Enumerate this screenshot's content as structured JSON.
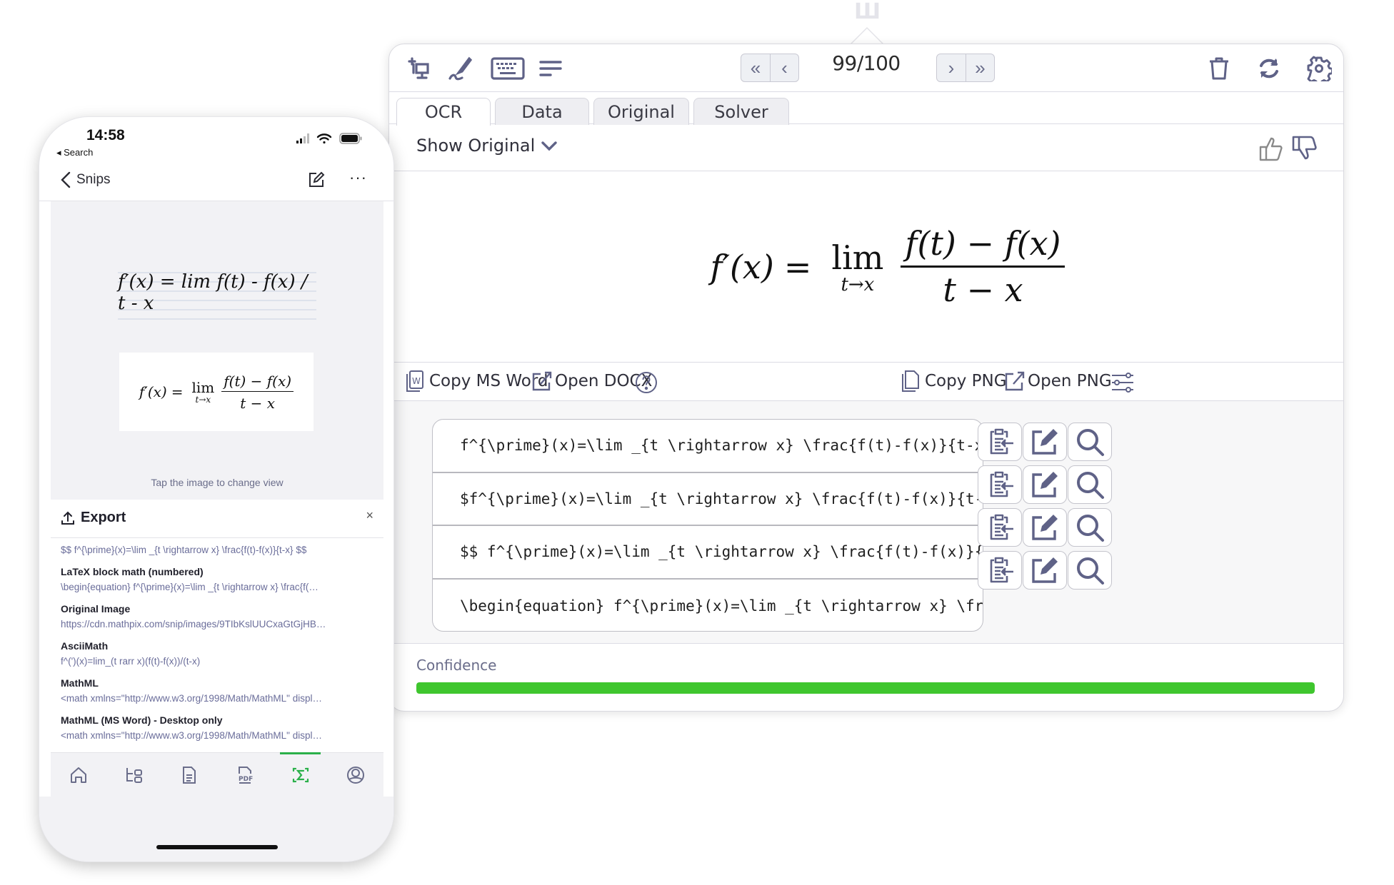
{
  "desktop": {
    "logo_glyph": "Ш",
    "toolbar": {
      "icons": [
        "screen-snip-icon",
        "handwriting-icon",
        "keyboard-icon",
        "menu-lines-icon"
      ],
      "nav": {
        "first": "«",
        "prev": "‹",
        "next": "›",
        "last": "»"
      },
      "page_counter": "99/100",
      "right_icons": [
        "trash-icon",
        "refresh-icon",
        "gear-icon"
      ]
    },
    "tabs": [
      {
        "label": "OCR",
        "active": true
      },
      {
        "label": "Data",
        "active": false
      },
      {
        "label": "Original",
        "active": false
      },
      {
        "label": "Solver",
        "active": false
      }
    ],
    "show_original_label": "Show Original",
    "rendered_math": {
      "lhs": "f′(x)",
      "eq": "=",
      "lim": "lim",
      "lim_sub": "t→x",
      "numerator": "f(t) − f(x)",
      "denominator": "t − x"
    },
    "export_bar": {
      "copy_word": "Copy MS Word",
      "open_docx": "Open DOCX",
      "copy_png": "Copy PNG",
      "open_png": "Open PNG"
    },
    "latex_formats": [
      "f^{\\prime}(x)=\\lim _{t \\rightarrow x} \\frac{f(t)-f(x)}{t-x}",
      "$f^{\\prime}(x)=\\lim _{t \\rightarrow x} \\frac{f(t)-f(x)}{t-x}$",
      "$$ f^{\\prime}(x)=\\lim _{t \\rightarrow x} \\frac{f(t)-f(x)}{t-x} $$",
      "\\begin{equation} f^{\\prime}(x)=\\lim _{t \\rightarrow x} \\frac{f(t)-f(…"
    ],
    "confidence": {
      "label": "Confidence",
      "value_percent": 100,
      "color": "#3fc62e"
    },
    "icon_color": "#5f6287"
  },
  "phone": {
    "status": {
      "time": "14:58",
      "back_label": "◂ Search"
    },
    "nav": {
      "back_label": "Snips",
      "more": "···"
    },
    "preview": {
      "handwritten": "f′(x) = lim f(t) - f(x) / t - x",
      "tap_hint": "Tap the image to change view"
    },
    "rendered_math": {
      "lhs": "f′(x)",
      "eq": "=",
      "lim": "lim",
      "lim_sub": "t→x",
      "numerator": "f(t) − f(x)",
      "denominator": "t − x"
    },
    "export": {
      "title": "Export",
      "close": "×",
      "partial_value": "$$ f^{\\prime}(x)=\\lim _{t \\rightarrow x} \\frac{f(t)-f(x)}{t-x} $$",
      "items": [
        {
          "name": "LaTeX block math (numbered)",
          "value": "\\begin{equation} f^{\\prime}(x)=\\lim _{t \\rightarrow x} \\frac{f(…"
        },
        {
          "name": "Original Image",
          "value": "https://cdn.mathpix.com/snip/images/9TIbKslUUCxaGtGjHB…"
        },
        {
          "name": "AsciiMath",
          "value": "f^(')(x)=lim_(t rarr x)(f(t)-f(x))/(t-x)"
        },
        {
          "name": "MathML",
          "value": "<math xmlns=\"http://www.w3.org/1998/Math/MathML\" displ…"
        },
        {
          "name": "MathML (MS Word) - Desktop only",
          "value": "<math xmlns=\"http://www.w3.org/1998/Math/MathML\" displ…"
        }
      ]
    },
    "tabbar": [
      {
        "icon": "home-icon",
        "active": false
      },
      {
        "icon": "folders-icon",
        "active": false
      },
      {
        "icon": "document-icon",
        "active": false
      },
      {
        "icon": "pdf-icon",
        "active": false
      },
      {
        "icon": "sigma-snip-icon",
        "active": true
      },
      {
        "icon": "profile-icon",
        "active": false
      }
    ],
    "accent_color": "#2bb04a"
  }
}
